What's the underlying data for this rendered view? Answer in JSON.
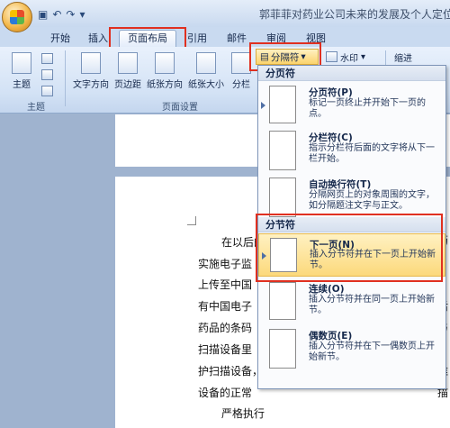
{
  "window": {
    "title": "郭菲菲对药业公司未来的发展及个人定位"
  },
  "tabs": [
    {
      "label": "开始"
    },
    {
      "label": "插入"
    },
    {
      "label": "页面布局"
    },
    {
      "label": "引用"
    },
    {
      "label": "邮件"
    },
    {
      "label": "审阅"
    },
    {
      "label": "视图"
    }
  ],
  "ribbon": {
    "theme_label": "主题",
    "theme_group_label": "主题",
    "text_direction": "文字方向",
    "margins": "页边距",
    "orientation": "纸张方向",
    "size": "纸张大小",
    "columns": "分栏",
    "page_setup_group_label": "页面设置",
    "breaks_label": "分隔符",
    "watermark_label": "水印",
    "indent_label": "缩进"
  },
  "menu": {
    "page_breaks_header": "分页符",
    "section_breaks_header": "分节符",
    "items": [
      {
        "title": "分页符(P)",
        "desc": "标记一页终止并开始下一页的点。"
      },
      {
        "title": "分栏符(C)",
        "desc": "指示分栏符后面的文字将从下一栏开始。"
      },
      {
        "title": "自动换行符(T)",
        "desc": "分隔网页上的对象周围的文字，如分隔题注文字与正文。"
      },
      {
        "title": "下一页(N)",
        "desc": "插入分节符并在下一页上开始新节。"
      },
      {
        "title": "连续(O)",
        "desc": "插入分节符并在同一页上开始新节。"
      },
      {
        "title": "偶数页(E)",
        "desc": "插入分节符并在下一偶数页上开始新节。"
      }
    ]
  },
  "document": {
    "lines": [
      "在以后的",
      "实施电子监",
      "上传至中国",
      "有中国电子",
      "药品的条码",
      "扫描设备里",
      "护扫描设备，",
      "设备的正常",
      "严格执行"
    ],
    "right_edge": [
      "药",
      "后",
      "与",
      "维",
      "描"
    ]
  }
}
